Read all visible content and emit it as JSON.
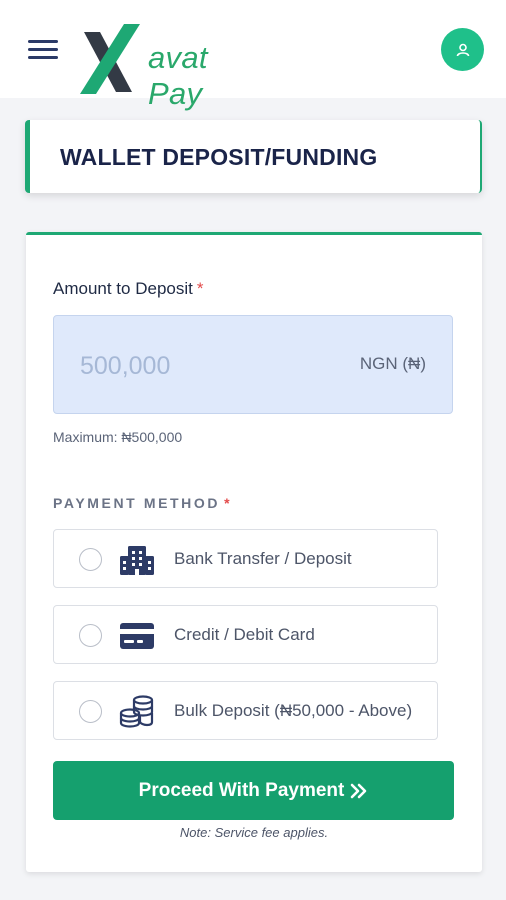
{
  "header": {
    "menu_icon": "hamburger-menu-icon",
    "logo_text": "avat Pay",
    "logo_mark": "X",
    "avatar_icon": "user-icon",
    "accent": "#1fc08a"
  },
  "title": "WALLET DEPOSIT/FUNDING",
  "form": {
    "amount_label": "Amount to Deposit",
    "required_mark": "*",
    "amount_placeholder": "500,000",
    "currency": "NGN (₦)",
    "maximum_note": "Maximum: ₦500,000",
    "payment_method_label": "PAYMENT METHOD",
    "options": [
      {
        "label": "Bank Transfer / Deposit",
        "icon": "bank-building-icon",
        "selected": false
      },
      {
        "label": "Credit / Debit Card",
        "icon": "credit-card-icon",
        "selected": false
      },
      {
        "label": "Bulk Deposit (₦50,000 - Above)",
        "icon": "coins-stack-icon",
        "selected": false
      }
    ],
    "proceed_label": "Proceed With Payment",
    "proceed_icon": "double-chevron-right-icon",
    "fee_note": "Note: Service fee applies."
  },
  "colors": {
    "primary_green": "#15a06e",
    "title_text": "#1a2449",
    "required": "#e34b4b",
    "amount_bg": "#dfe9fb"
  }
}
